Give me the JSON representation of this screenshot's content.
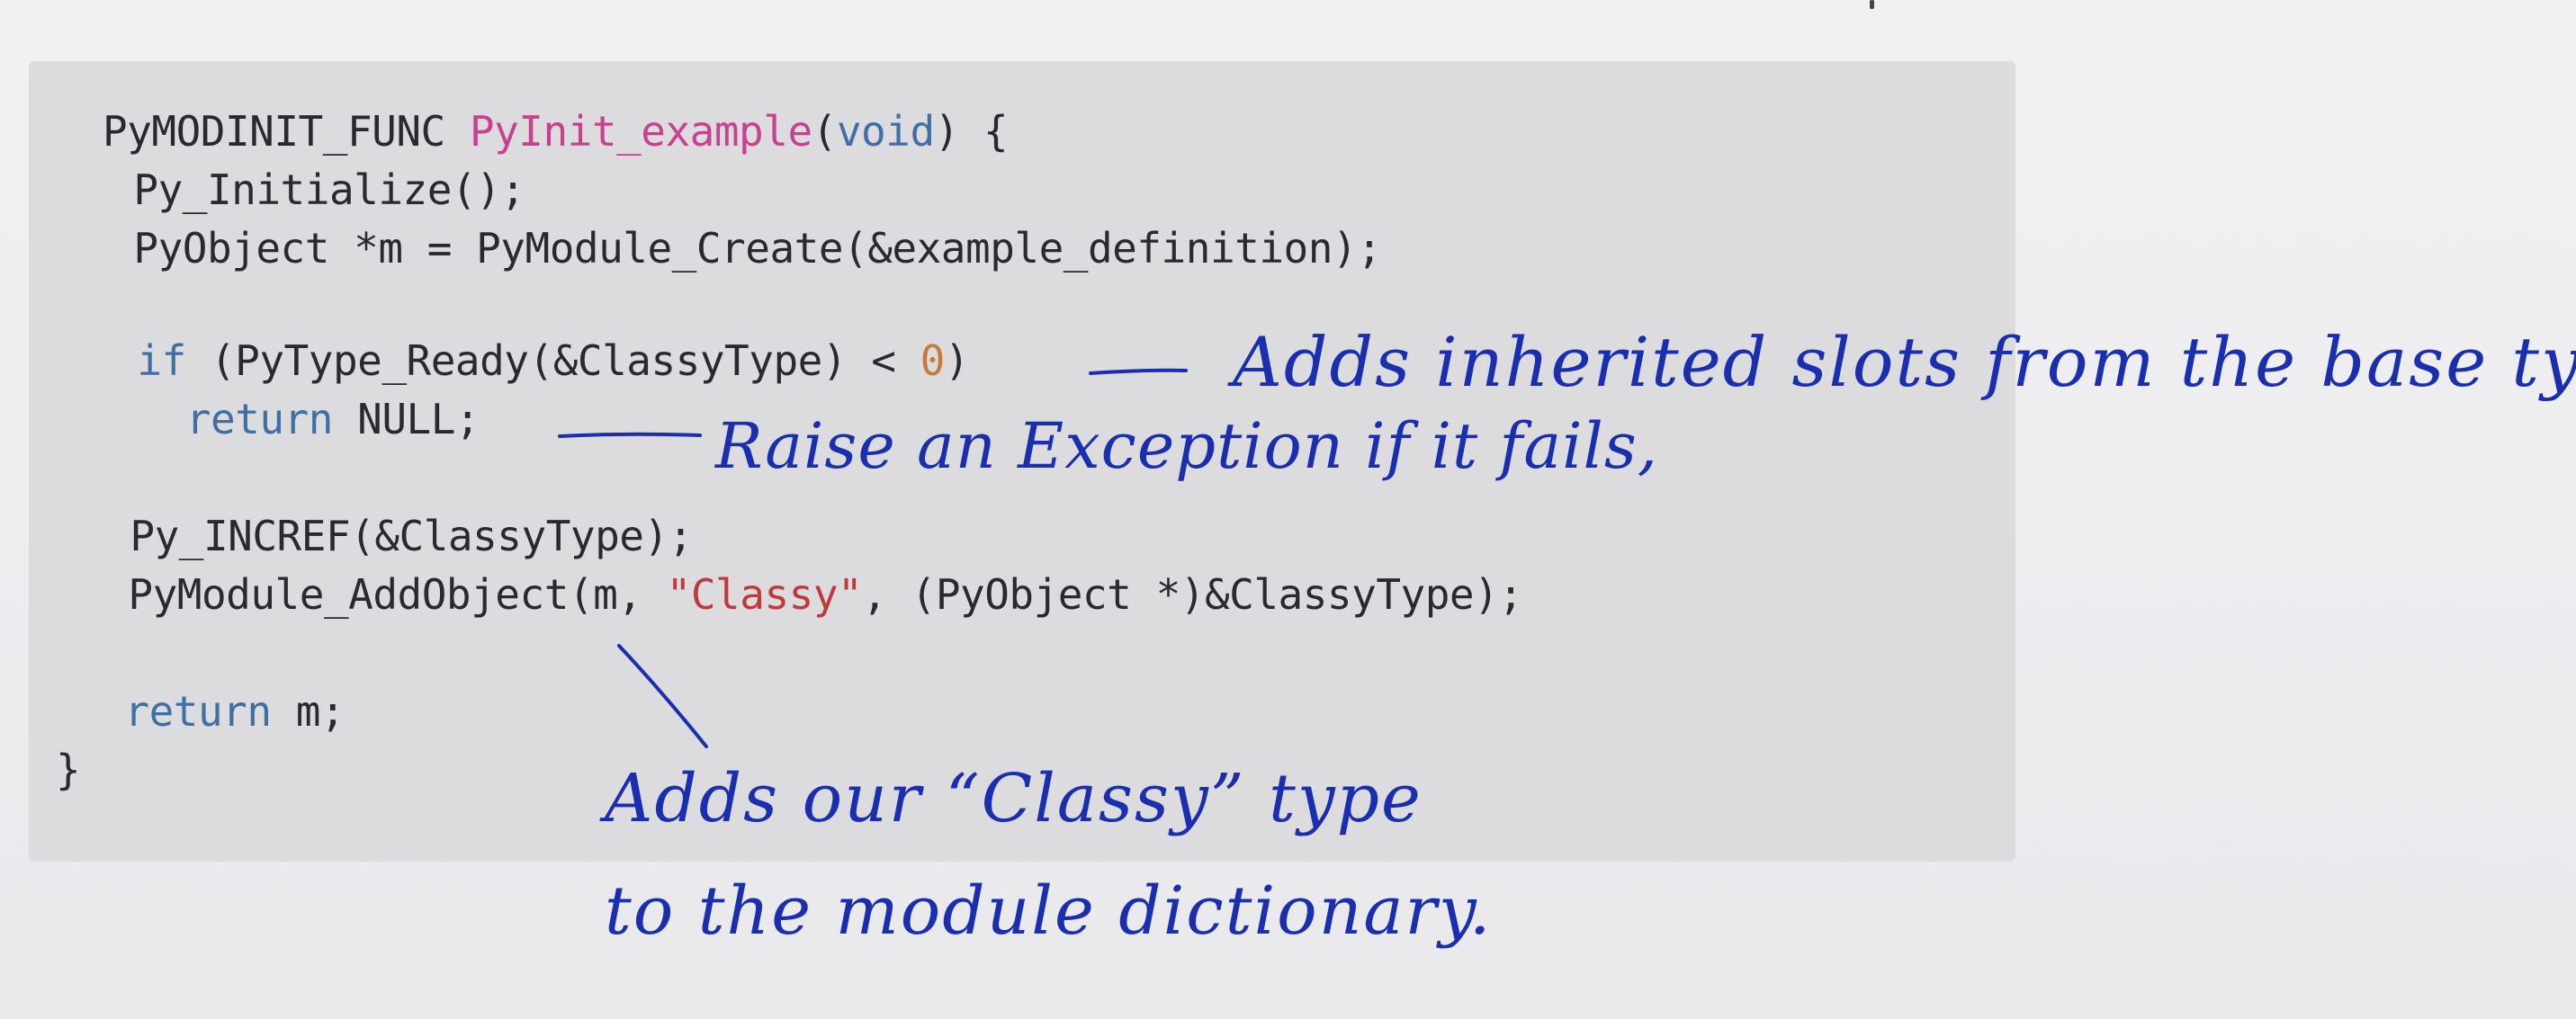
{
  "code": {
    "lines": [
      [
        {
          "t": "PyMODINIT_FUNC ",
          "c": ""
        },
        {
          "t": "PyInit_example",
          "c": "fn"
        },
        {
          "t": "(",
          "c": ""
        },
        {
          "t": "void",
          "c": "kw"
        },
        {
          "t": ") {",
          "c": ""
        }
      ],
      [
        {
          "t": "  Py_Initialize();",
          "c": ""
        }
      ],
      [
        {
          "t": "  PyObject *m = PyModule_Create(&example_definition);",
          "c": ""
        }
      ],
      [
        {
          "t": "",
          "c": ""
        }
      ],
      [
        {
          "t": "  ",
          "c": ""
        },
        {
          "t": "if",
          "c": "kw"
        },
        {
          "t": " (PyType_Ready(&ClassyType) < ",
          "c": ""
        },
        {
          "t": "0",
          "c": "num"
        },
        {
          "t": ")",
          "c": ""
        }
      ],
      [
        {
          "t": "    ",
          "c": ""
        },
        {
          "t": "return",
          "c": "kw"
        },
        {
          "t": " NULL;",
          "c": ""
        }
      ],
      [
        {
          "t": "",
          "c": ""
        }
      ],
      [
        {
          "t": "  Py_INCREF(&ClassyType);",
          "c": ""
        }
      ],
      [
        {
          "t": "  PyModule_AddObject(m, ",
          "c": ""
        },
        {
          "t": "\"Classy\"",
          "c": "str"
        },
        {
          "t": ", (PyObject *)&ClassyType);",
          "c": ""
        }
      ],
      [
        {
          "t": "",
          "c": ""
        }
      ],
      [
        {
          "t": "  ",
          "c": ""
        },
        {
          "t": "return",
          "c": "kw"
        },
        {
          "t": " m;",
          "c": ""
        }
      ],
      [
        {
          "t": "}",
          "c": ""
        }
      ]
    ]
  },
  "annotations": {
    "inherited": "Adds inherited slots from the base type.",
    "raise": "Raise an Exception if it fails,",
    "adds_line1": "Adds our “Classy” type",
    "adds_line2": "to the module dictionary."
  },
  "colors": {
    "ink": "#1a2fb0",
    "keyword": "#3f6fa4",
    "function": "#c8408f",
    "number": "#c77a3b",
    "string": "#c0393b"
  }
}
